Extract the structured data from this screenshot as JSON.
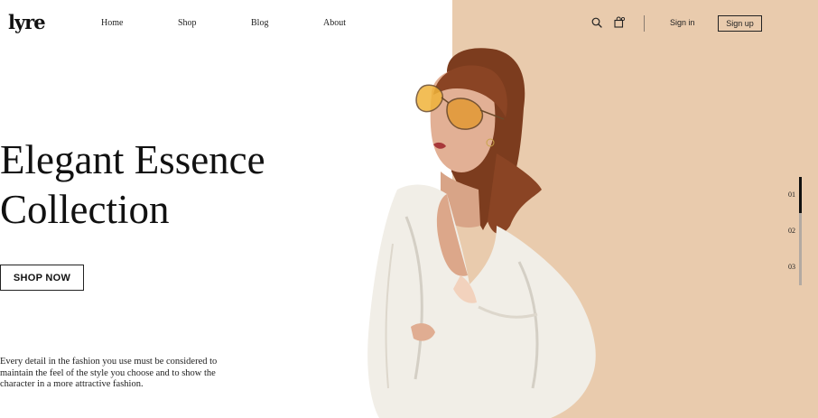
{
  "brand": {
    "logo": "lyre"
  },
  "nav": {
    "links": [
      "Home",
      "Shop",
      "Blog",
      "About"
    ],
    "signin_label": "Sign in",
    "signup_label": "Sign up",
    "icons": [
      "search-icon",
      "bag-icon"
    ]
  },
  "hero": {
    "title_line1": "Elegant Essence",
    "title_line2": "Collection",
    "cta_label": "SHOP NOW",
    "description": "Every detail in the fashion you use must be considered to maintain the feel of the style you choose and to show the character in a more attractive fashion."
  },
  "slider": {
    "slides": [
      "01",
      "02",
      "03"
    ],
    "active_index": 0
  },
  "colors": {
    "panel_bg": "#e9cbad",
    "text": "#111111"
  }
}
